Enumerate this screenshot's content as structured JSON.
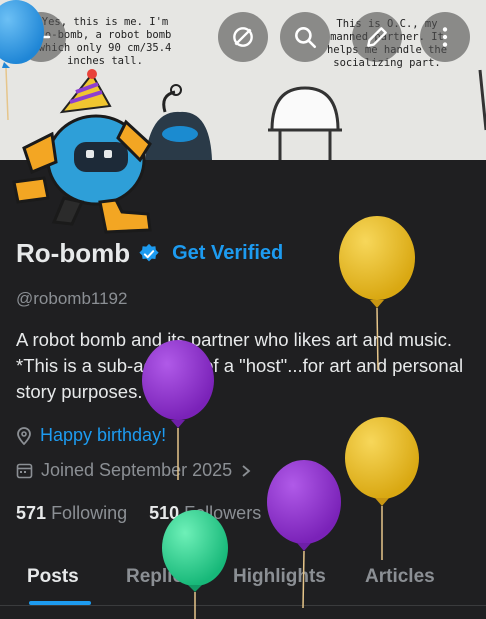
{
  "banner": {
    "left_text": "Yes, this is me. I'm Ro-bomb, a robot bomb which only 90 cm/35.4 inches tall.",
    "right_text": "This is O.C., my manned partner. It helps me handle the socializing part."
  },
  "profile": {
    "name": "Ro-bomb",
    "get_verified_label": "Get Verified",
    "handle": "@robomb1192",
    "bio": "A robot bomb and its partner who likes art and music.  *This is a sub-account of a \"host\"...for art and personal story purposes.",
    "birthday": "Happy birthday!",
    "joined": "Joined September 2025",
    "following_count": "571",
    "following_label": "Following",
    "followers_count": "510",
    "followers_label": "Followers"
  },
  "tabs": [
    "Posts",
    "Replies",
    "Highlights",
    "Articles"
  ],
  "colors": {
    "accent": "#1d9bf0",
    "background": "#1f1f21",
    "balloon_yellow": "#e0b21a",
    "balloon_purple": "#8e2fc9",
    "balloon_green": "#2fd38f",
    "balloon_blue": "#2f9be8"
  }
}
